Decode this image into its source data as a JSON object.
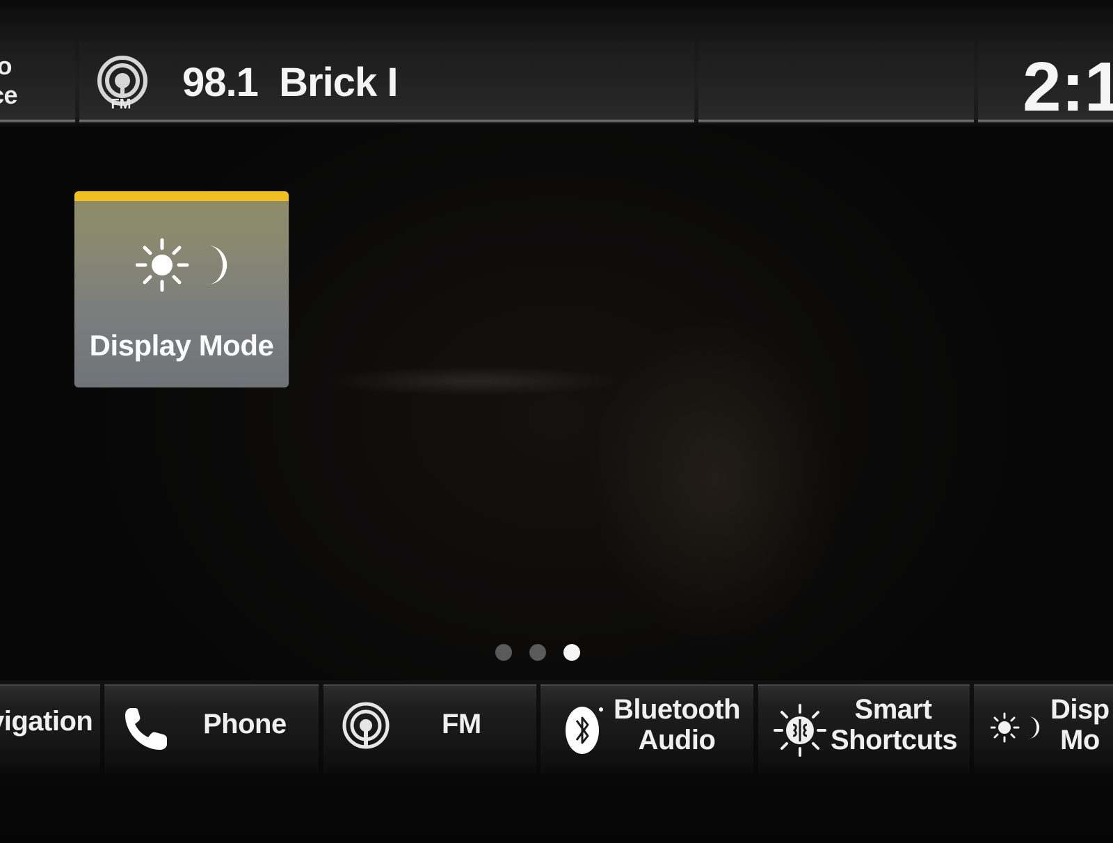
{
  "status_bar": {
    "source_line1": "io",
    "source_line2": "ce",
    "station": "98.1  Brick I",
    "fm_badge_label": "FM",
    "clock": "2:1",
    "station_icon": "fm-radio-icon"
  },
  "home": {
    "tiles": [
      {
        "label": "Display Mode",
        "icon": "sun-moon-icon",
        "accent_color": "#f0c020"
      }
    ],
    "pager": {
      "pages": 3,
      "active_page": 3
    }
  },
  "dock": {
    "items": [
      {
        "label": "vigation",
        "icon": ""
      },
      {
        "label": "Phone",
        "icon": "phone-icon"
      },
      {
        "label": "FM",
        "icon": "radio-signal-icon"
      },
      {
        "label_line1": "Bluetooth",
        "label_line2": "Audio",
        "icon": "bluetooth-icon"
      },
      {
        "label_line1": "Smart",
        "label_line2": "Shortcuts",
        "icon": "smart-brain-icon"
      },
      {
        "label_line1": "Disp",
        "label_line2": "Mo",
        "icon": "sun-moon-icon"
      }
    ]
  }
}
